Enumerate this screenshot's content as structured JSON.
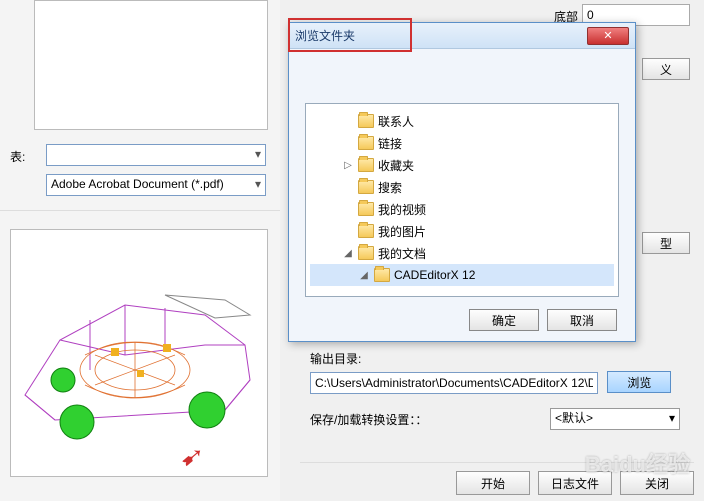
{
  "top": {
    "label": "底部",
    "value": "0"
  },
  "left": {
    "biao_label": "表:",
    "format": "Adobe Acrobat Document (*.pdf)"
  },
  "dialog": {
    "title": "浏览文件夹",
    "tree": [
      {
        "label": "联系人",
        "indent": 1,
        "exp": ""
      },
      {
        "label": "链接",
        "indent": 1,
        "exp": ""
      },
      {
        "label": "收藏夹",
        "indent": 1,
        "exp": "▷"
      },
      {
        "label": "搜索",
        "indent": 1,
        "exp": ""
      },
      {
        "label": "我的视频",
        "indent": 1,
        "exp": ""
      },
      {
        "label": "我的图片",
        "indent": 1,
        "exp": ""
      },
      {
        "label": "我的文档",
        "indent": 1,
        "exp": "◢"
      },
      {
        "label": "CADEditorX 12",
        "indent": 2,
        "exp": "◢",
        "selected": true
      }
    ],
    "ok": "确定",
    "cancel": "取消"
  },
  "right": {
    "btn_yi": "义",
    "btn_xing": "型"
  },
  "output": {
    "label": "输出目录:",
    "path": "C:\\Users\\Administrator\\Documents\\CADEditorX 12\\D",
    "browse": "浏览"
  },
  "save": {
    "label": "保存/加载转换设置：：",
    "value": "<默认>"
  },
  "bottom": {
    "start": "开始",
    "log": "日志文件",
    "close": "关闭"
  },
  "watermark": "Baidu经验"
}
